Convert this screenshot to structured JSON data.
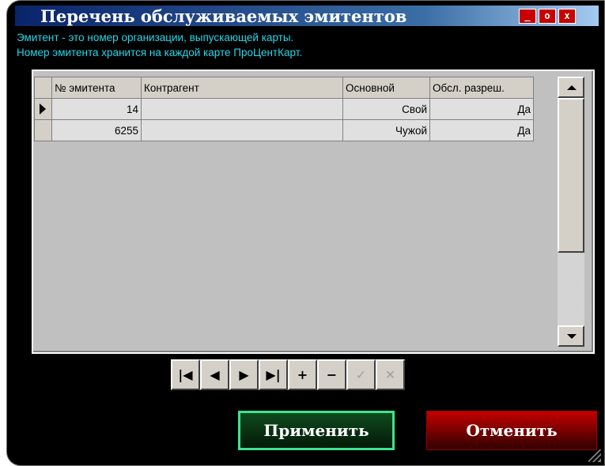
{
  "window": {
    "title": "Перечень обслуживаемых эмитентов",
    "minimize_label": "_",
    "maximize_label": "o",
    "close_label": "x"
  },
  "info": {
    "line1": "Эмитент - это номер организации, выпускающей карты.",
    "line2": "Номер эмитента хранится на каждой карте ПроЦентКарт."
  },
  "grid": {
    "columns": [
      "№ эмитента",
      "Контрагент",
      "Основной",
      "Обсл. разреш."
    ],
    "rows": [
      {
        "emitent": "14",
        "contragent": "",
        "main": "Свой",
        "allowed": "Да"
      },
      {
        "emitent": "6255",
        "contragent": "",
        "main": "Чужой",
        "allowed": "Да"
      }
    ],
    "selected_row": 0
  },
  "navigator": {
    "buttons": [
      {
        "name": "first-record-button",
        "glyph": "|◀",
        "enabled": true
      },
      {
        "name": "prior-record-button",
        "glyph": "◀",
        "enabled": true
      },
      {
        "name": "next-record-button",
        "glyph": "▶",
        "enabled": true
      },
      {
        "name": "last-record-button",
        "glyph": "▶|",
        "enabled": true
      },
      {
        "name": "insert-record-button",
        "glyph": "+",
        "enabled": true
      },
      {
        "name": "delete-record-button",
        "glyph": "−",
        "enabled": true
      },
      {
        "name": "post-record-button",
        "glyph": "✓",
        "enabled": false
      },
      {
        "name": "cancel-edit-button",
        "glyph": "✕",
        "enabled": false
      }
    ]
  },
  "actions": {
    "apply_label": "Применить",
    "cancel_label": "Отменить"
  },
  "colors": {
    "info_text": "#27d6e9",
    "apply_border": "#3ce58d",
    "cancel_bg": "#c40000",
    "close_btn": "#c80000"
  }
}
